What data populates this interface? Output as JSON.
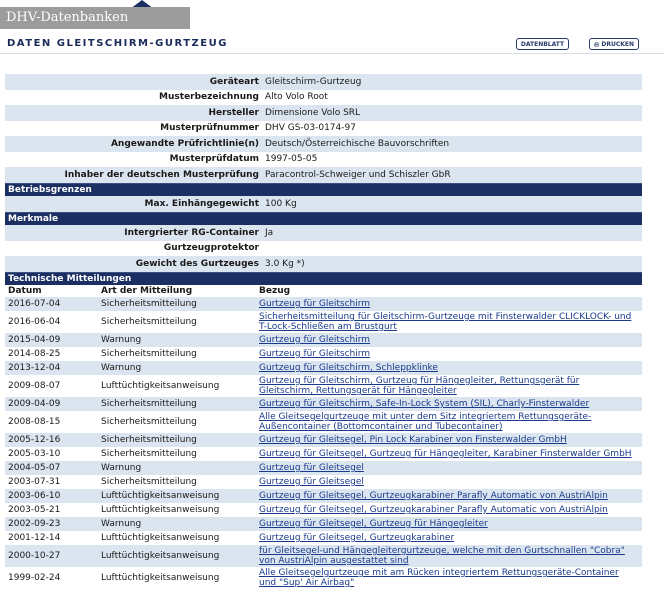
{
  "header": {
    "brand": "DHV-Datenbanken",
    "page_title": "DATEN GLEITSCHIRM-GURTZEUG",
    "btn_datenblatt": "DATENBLATT",
    "btn_drucken": "DRUCKEN"
  },
  "info": [
    {
      "label": "Geräteart",
      "value": "Gleitschirm-Gurtzeug"
    },
    {
      "label": "Musterbezeichnung",
      "value": "Alto Volo Root"
    },
    {
      "label": "Hersteller",
      "value": "Dimensione Volo SRL"
    },
    {
      "label": "Musterprüfnummer",
      "value": "DHV GS-03-0174-97"
    },
    {
      "label": "Angewandte Prüfrichtlinie(n)",
      "value": "Deutsch/Österreichische Bauvorschriften"
    },
    {
      "label": "Musterprüfdatum",
      "value": "1997-05-05"
    },
    {
      "label": "Inhaber der deutschen Musterprüfung",
      "value": "Paracontrol-Schweiger und Schiszler GbR"
    }
  ],
  "sections": {
    "betriebsgrenzen": "Betriebsgrenzen",
    "merkmale": "Merkmale",
    "technische": "Technische Mitteilungen"
  },
  "betriebsgrenzen": [
    {
      "label": "Max. Einhängegewicht",
      "value": "100 Kg"
    }
  ],
  "merkmale": [
    {
      "label": "Intergrierter RG-Container",
      "value": "Ja"
    },
    {
      "label": "Gurtzeugprotektor",
      "value": ""
    },
    {
      "label": "Gewicht des Gurtzeuges",
      "value": "3.0 Kg *)"
    }
  ],
  "table": {
    "headers": [
      "Datum",
      "Art der Mitteilung",
      "Bezug"
    ],
    "rows": [
      {
        "date": "2016-07-04",
        "type": "Sicherheitsmitteilung",
        "ref": "Gurtzeug für Gleitschirm"
      },
      {
        "date": "2016-06-04",
        "type": "Sicherheitsmitteilung",
        "ref": "Sicherheitsmitteilung für Gleitschirm-Gurtzeuge mit Finsterwalder CLICKLOCK- und T-Lock-Schließen am Brustgurt"
      },
      {
        "date": "2015-04-09",
        "type": "Warnung",
        "ref": "Gurtzeug für Gleitschirm"
      },
      {
        "date": "2014-08-25",
        "type": "Sicherheitsmitteilung",
        "ref": "Gurtzeug für Gleitschirm"
      },
      {
        "date": "2013-12-04",
        "type": "Warnung",
        "ref": "Gurtzeug für Gleitschirm, Schleppklinke"
      },
      {
        "date": "2009-08-07",
        "type": "Lufttüchtigkeitsanweisung",
        "ref": "Gurtzeug für Gleitschirm, Gurtzeug für Hängegleiter, Rettungsgerät für Gleitschirm, Rettungsgerät für Hängegleiter"
      },
      {
        "date": "2009-04-09",
        "type": "Sicherheitsmitteilung",
        "ref": "Gurtzeug für Gleitschirm, Safe-In-Lock System (SIL), Charly-Finsterwalder"
      },
      {
        "date": "2008-08-15",
        "type": "Sicherheitsmitteilung",
        "ref": "Alle Gleitsegelgurtzeuge mit unter dem Sitz integriertem Rettungsgeräte-Außencontainer (Bottomcontainer und Tubecontainer)"
      },
      {
        "date": "2005-12-16",
        "type": "Sicherheitsmitteilung",
        "ref": "Gurtzeug für Gleitsegel, Pin Lock Karabiner von Finsterwalder GmbH"
      },
      {
        "date": "2005-03-10",
        "type": "Sicherheitsmitteilung",
        "ref": "Gurtzeug für Gleitsegel, Gurtzeug für Hängegleiter, Karabiner Finsterwalder GmbH"
      },
      {
        "date": "2004-05-07",
        "type": "Warnung",
        "ref": "Gurtzeug für Gleitsegel"
      },
      {
        "date": "2003-07-31",
        "type": "Sicherheitsmitteilung",
        "ref": "Gurtzeug für Gleitsegel"
      },
      {
        "date": "2003-06-10",
        "type": "Lufttüchtigkeitsanweisung",
        "ref": "Gurtzeug für Gleitsegel, Gurtzeugkarabiner Parafly Automatic von AustriAlpin"
      },
      {
        "date": "2003-05-21",
        "type": "Lufttüchtigkeitsanweisung",
        "ref": "Gurtzeug für Gleitsegel, Gurtzeugkarabiner Parafly Automatic von AustriAlpin"
      },
      {
        "date": "2002-09-23",
        "type": "Warnung",
        "ref": "Gurtzeug für Gleitsegel, Gurtzeug für Hängegleiter"
      },
      {
        "date": "2001-12-14",
        "type": "Lufttüchtigkeitsanweisung",
        "ref": "Gurtzeug für Gleitsegel, Gurtzeugkarabiner"
      },
      {
        "date": "2000-10-27",
        "type": "Lufttüchtigkeitsanweisung",
        "ref": "für Gleitsegel-und Hängegleitergurtzeuge, welche mit den Gurtschnallen \"Cobra\" von AustriAlpin ausgestattet sind"
      },
      {
        "date": "1999-02-24",
        "type": "Lufttüchtigkeitsanweisung",
        "ref": "Alle Gleitsegelgurtzeuge mit am Rücken integriertem Rettungsgeräte-Container und \"Sup' Air Airbag\""
      }
    ]
  },
  "colors": {
    "section_bg": "#1b2f63",
    "row_alt_bg": "#dbe5ef",
    "link": "#1a3a8c",
    "brand_tab": "#9c9c9c"
  }
}
